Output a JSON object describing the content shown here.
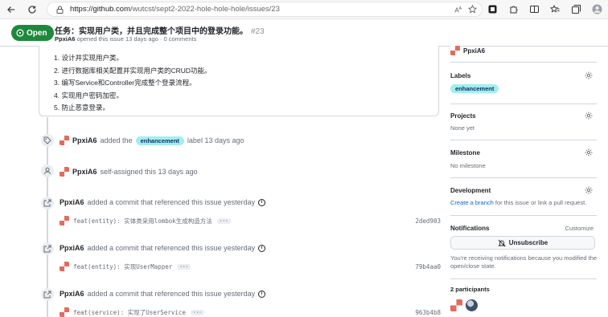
{
  "browser": {
    "url_host": "https://github.com",
    "url_path": "/wutcst/sept2-2022-hole-hole-hole/issues/23",
    "reader_label": "Aᴬ"
  },
  "issue": {
    "state": "Open",
    "title": "任务：实现用户类，并且完成整个项目中的登录功能。",
    "number": "#23",
    "author": "PpxiA6",
    "meta": " opened this issue 13 days ago · 0 comments"
  },
  "body": {
    "tasks": [
      "1. 设计并实现用户类。",
      "2. 进行数据库相关配置并实现用户类的CRUD功能。",
      "3. 编写Service和Controller完成整个登录流程。",
      "4. 实现用户密码加密。",
      "5. 防止恶意登录。"
    ]
  },
  "timeline": {
    "label_event": {
      "actor": "PpxiA6",
      "pre": "added the",
      "label": "enhancement",
      "post": "label 13 days ago"
    },
    "assign_event": {
      "actor": "PpxiA6",
      "text": "self-assigned this 13 days ago"
    },
    "commits": [
      {
        "actor": "PpxiA6",
        "text": "added a commit that referenced this issue yesterday",
        "message": "feat(entity): 实体类采用lombok生成构造方法",
        "more": "···",
        "sha": "2ded903"
      },
      {
        "actor": "PpxiA6",
        "text": "added a commit that referenced this issue yesterday",
        "message": "feat(entity): 实现UserMapper",
        "more": "···",
        "sha": "79b4aa0"
      },
      {
        "actor": "PpxiA6",
        "text": "added a commit that referenced this issue yesterday",
        "message": "feat(service): 实现了UserService",
        "more": "···",
        "sha": "963b4b8"
      }
    ]
  },
  "sidebar": {
    "assignee": "PpxiA6",
    "labels_heading": "Labels",
    "label": "enhancement",
    "projects_heading": "Projects",
    "projects_value": "None yet",
    "milestone_heading": "Milestone",
    "milestone_value": "No milestone",
    "development_heading": "Development",
    "development_link": "Create a branch",
    "development_text": " for this issue or link a pull request.",
    "notifications_heading": "Notifications",
    "customize": "Customize",
    "unsubscribe": "Unsubscribe",
    "notif_text_1": "You're receiving notifications because you modified the",
    "notif_text_2": "open/close state.",
    "participants": "2 participants"
  },
  "colors": {
    "open_green": "#1f883d",
    "label_bg": "#a2eeef",
    "link_blue": "#0969da"
  }
}
